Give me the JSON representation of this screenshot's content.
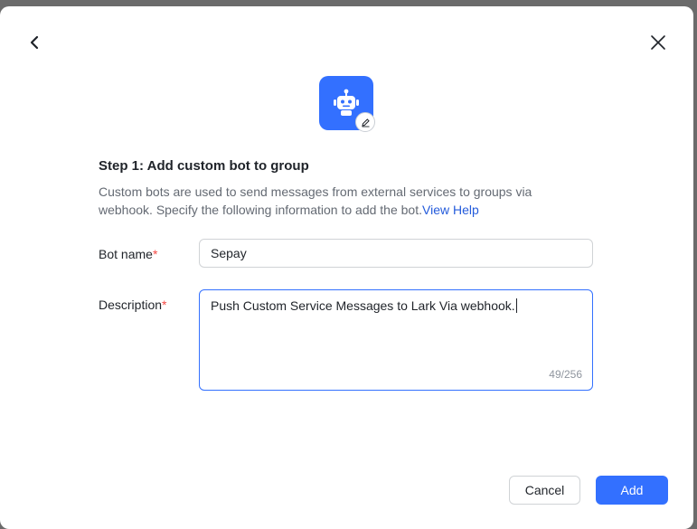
{
  "dialog": {
    "step_title": "Step 1: Add custom bot to group",
    "description": "Custom bots are used to send messages from external services to groups via webhook. Specify the following information to add the bot.",
    "help_link": "View Help"
  },
  "form": {
    "bot_name_label": "Bot name",
    "bot_name_value": "Sepay",
    "description_label": "Description",
    "description_value": "Push Custom Service Messages to Lark Via webhook.",
    "description_counter": "49/256",
    "required_marker": "*"
  },
  "footer": {
    "cancel_label": "Cancel",
    "add_label": "Add"
  },
  "colors": {
    "accent": "#3370ff",
    "required": "#f54a45",
    "link": "#245bdb"
  },
  "icons": {
    "back": "chevron-left-icon",
    "close": "close-icon",
    "bot": "robot-icon",
    "edit": "pencil-icon"
  }
}
